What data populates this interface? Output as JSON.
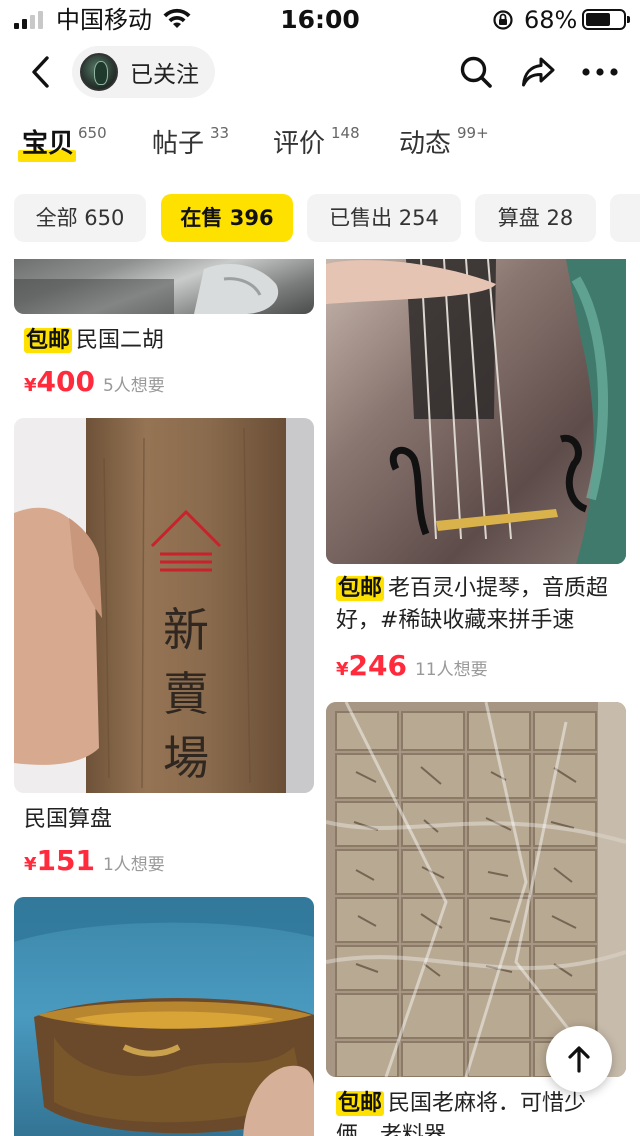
{
  "status_bar": {
    "carrier": "中国移动",
    "time": "16:00",
    "battery_pct": "68%",
    "battery_level": 0.68,
    "signal_bars_filled": 2,
    "signal_bars_total": 4
  },
  "header": {
    "back_icon": "chevron-left-icon",
    "follow_label": "已关注",
    "icons": [
      "search-icon",
      "share-icon",
      "more-icon"
    ]
  },
  "tabs": [
    {
      "label": "宝贝",
      "count": "650",
      "active": true
    },
    {
      "label": "帖子",
      "count": "33",
      "active": false
    },
    {
      "label": "评价",
      "count": "148",
      "active": false
    },
    {
      "label": "动态",
      "count": "99+",
      "active": false
    }
  ],
  "filters": [
    {
      "label": "全部 650",
      "active": false
    },
    {
      "label": "在售 396",
      "active": true
    },
    {
      "label": "已售出 254",
      "active": false
    },
    {
      "label": "算盘 28",
      "active": false
    }
  ],
  "items": {
    "erhu": {
      "tag": "包邮",
      "title": "民国二胡",
      "yen": "¥",
      "price": "400",
      "wants": "5人想要"
    },
    "violin": {
      "tag": "包邮",
      "title": "老百灵小提琴，音质超好，#稀缺收藏来拼手速",
      "yen": "¥",
      "price": "246",
      "wants": "11人想要"
    },
    "abacus": {
      "title": "民国算盘",
      "yen": "¥",
      "price": "151",
      "wants": "1人想要",
      "image_text": "新賣場"
    },
    "mahjong": {
      "tag": "包邮",
      "title": "民国老麻将．可惜少俩，老料器"
    },
    "bowl": {}
  },
  "colors": {
    "accent_yellow": "#ffe100",
    "price_red": "#ff2b3d",
    "chip_bg": "#f3f3f3"
  }
}
